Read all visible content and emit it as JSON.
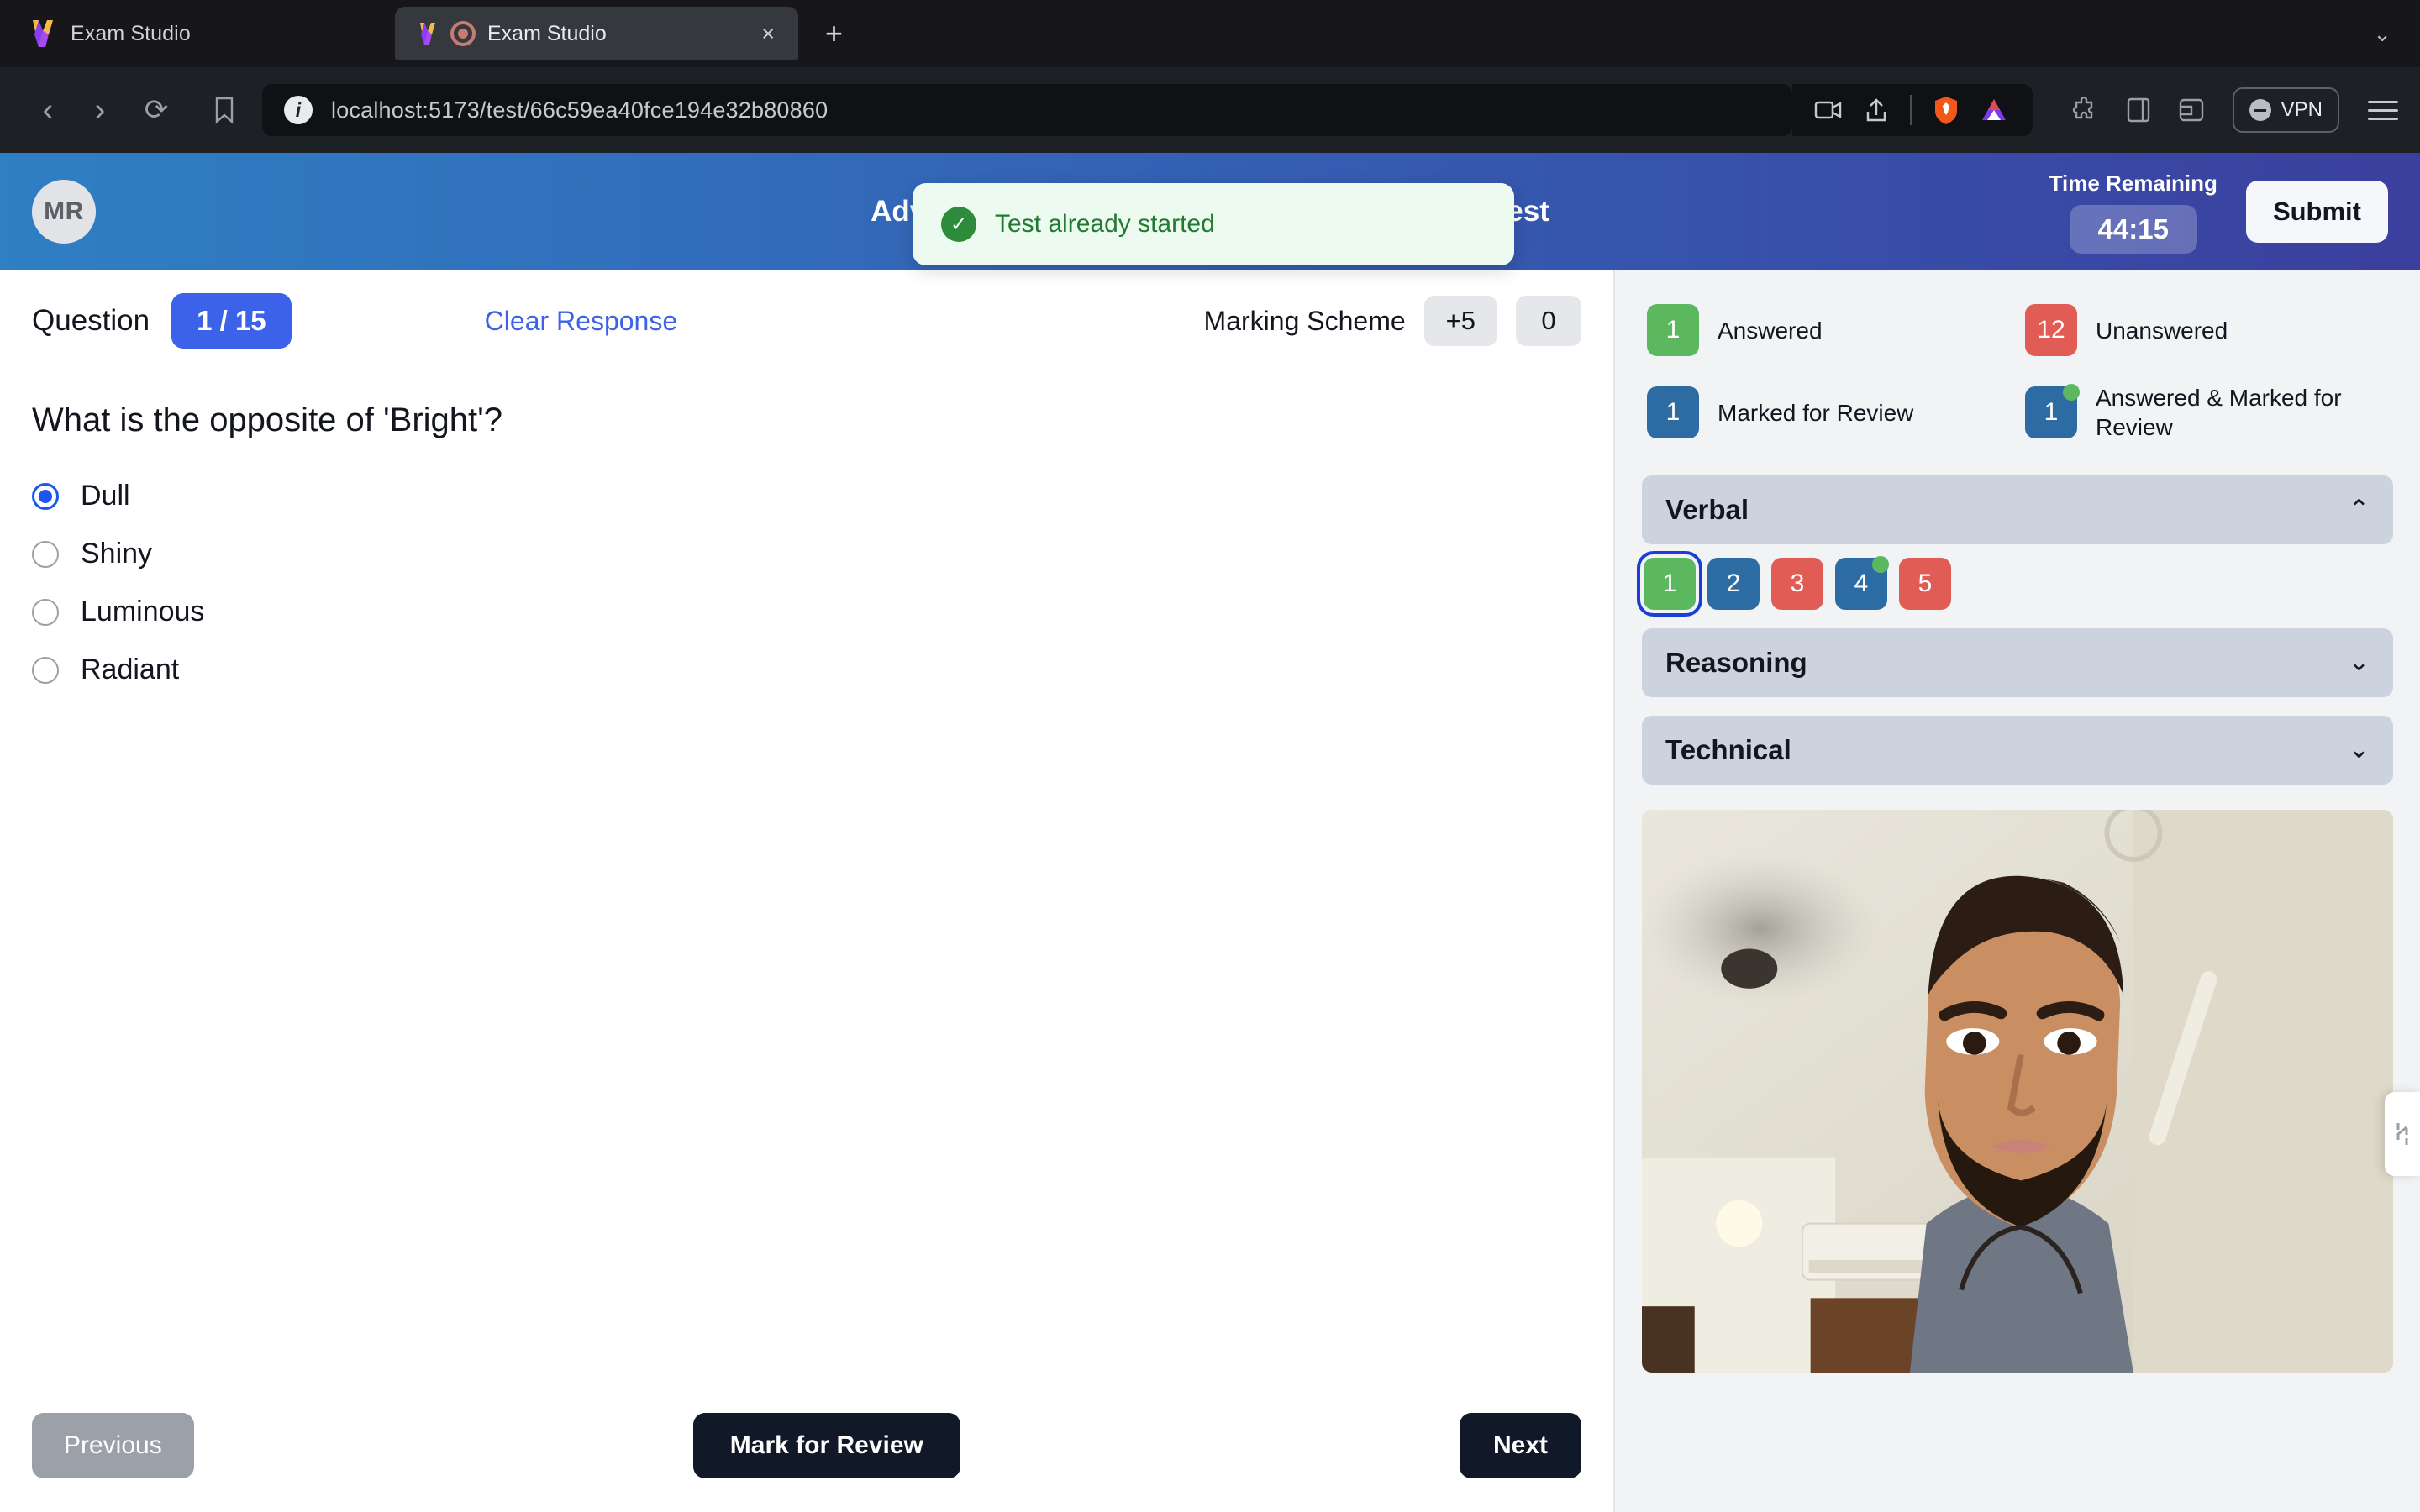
{
  "browser": {
    "window_app_name": "Exam Studio",
    "tab": {
      "title": "Exam Studio",
      "close_label": "×",
      "recording": true
    },
    "new_tab_label": "+",
    "tab_list_chevron": "⌄",
    "url": "localhost:5173/test/66c59ea40fce194e32b80860",
    "vpn_label": "VPN",
    "icons": {
      "back": "back-arrow-icon",
      "forward": "forward-arrow-icon",
      "reload": "reload-icon",
      "bookmark": "bookmark-icon",
      "site-info": "site-info-icon",
      "video-call": "video-call-icon",
      "share": "share-icon",
      "brave-shields": "brave-shields-icon",
      "brave-rewards": "brave-rewards-icon",
      "extensions": "extensions-puzzle-icon",
      "sidebar": "sidebar-panel-icon",
      "wallet": "brave-wallet-icon",
      "menu": "hamburger-menu-icon"
    }
  },
  "header": {
    "avatar_initials": "MR",
    "exam_title": "Advanced Logical Reasoning and Technical Test",
    "timer_label": "Time Remaining",
    "timer_value": "44:15",
    "submit_label": "Submit"
  },
  "toast": {
    "message": "Test already started",
    "icon": "check-circle-icon",
    "type": "success",
    "bg_color": "#edfaef",
    "text_color": "#227a32"
  },
  "question_toolbar": {
    "question_label": "Question",
    "question_counter": "1 / 15",
    "clear_response_label": "Clear Response",
    "marking_scheme_label": "Marking Scheme",
    "marks_correct": "+5",
    "marks_incorrect": "0"
  },
  "question": {
    "text": "What is the opposite of 'Bright'?",
    "options": [
      {
        "label": "Dull",
        "selected": true
      },
      {
        "label": "Shiny",
        "selected": false
      },
      {
        "label": "Luminous",
        "selected": false
      },
      {
        "label": "Radiant",
        "selected": false
      }
    ]
  },
  "footer": {
    "previous_label": "Previous",
    "previous_disabled": true,
    "mark_for_review_label": "Mark for Review",
    "next_label": "Next"
  },
  "legend": [
    {
      "count": "1",
      "label": "Answered",
      "color": "#5cb85f",
      "dot": false
    },
    {
      "count": "12",
      "label": "Unanswered",
      "color": "#e05c54",
      "dot": false
    },
    {
      "count": "1",
      "label": "Marked for Review",
      "color": "#2d6ba3",
      "dot": false
    },
    {
      "count": "1",
      "label": "Answered & Marked for Review",
      "color": "#2d6ba3",
      "dot": true
    }
  ],
  "sections": [
    {
      "name": "Verbal",
      "expanded": true,
      "chevron": "⌃",
      "questions": [
        {
          "number": "1",
          "state": "answered",
          "current": true
        },
        {
          "number": "2",
          "state": "marked",
          "current": false
        },
        {
          "number": "3",
          "state": "unanswered",
          "current": false
        },
        {
          "number": "4",
          "state": "answered-and-marked",
          "current": false
        },
        {
          "number": "5",
          "state": "unanswered",
          "current": false
        }
      ]
    },
    {
      "name": "Reasoning",
      "expanded": false,
      "chevron": "⌄",
      "questions": []
    },
    {
      "name": "Technical",
      "expanded": false,
      "chevron": "⌄",
      "questions": []
    }
  ],
  "proctor_camera": {
    "name": "webcam-proctoring-feed",
    "active": true
  },
  "side_handle": {
    "name": "panel-resize-handle"
  }
}
